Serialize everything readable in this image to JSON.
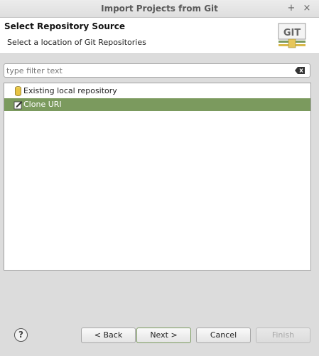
{
  "window": {
    "title": "Import Projects from Git",
    "maximize_glyph": "+",
    "close_glyph": "×"
  },
  "header": {
    "title": "Select Repository Source",
    "description": "Select a location of Git Repositories",
    "logo_text": "GIT"
  },
  "filter": {
    "placeholder": "type filter text",
    "value": ""
  },
  "list": {
    "items": [
      {
        "label": "Existing local repository",
        "icon": "repository-icon",
        "selected": false
      },
      {
        "label": "Clone URI",
        "icon": "clone-uri-icon",
        "selected": true
      }
    ]
  },
  "footer": {
    "help_glyph": "?",
    "back_label": "< Back",
    "next_label": "Next >",
    "cancel_label": "Cancel",
    "finish_label": "Finish"
  },
  "colors": {
    "selection": "#7b9a5e",
    "default_button_border": "#7a9a5e"
  }
}
